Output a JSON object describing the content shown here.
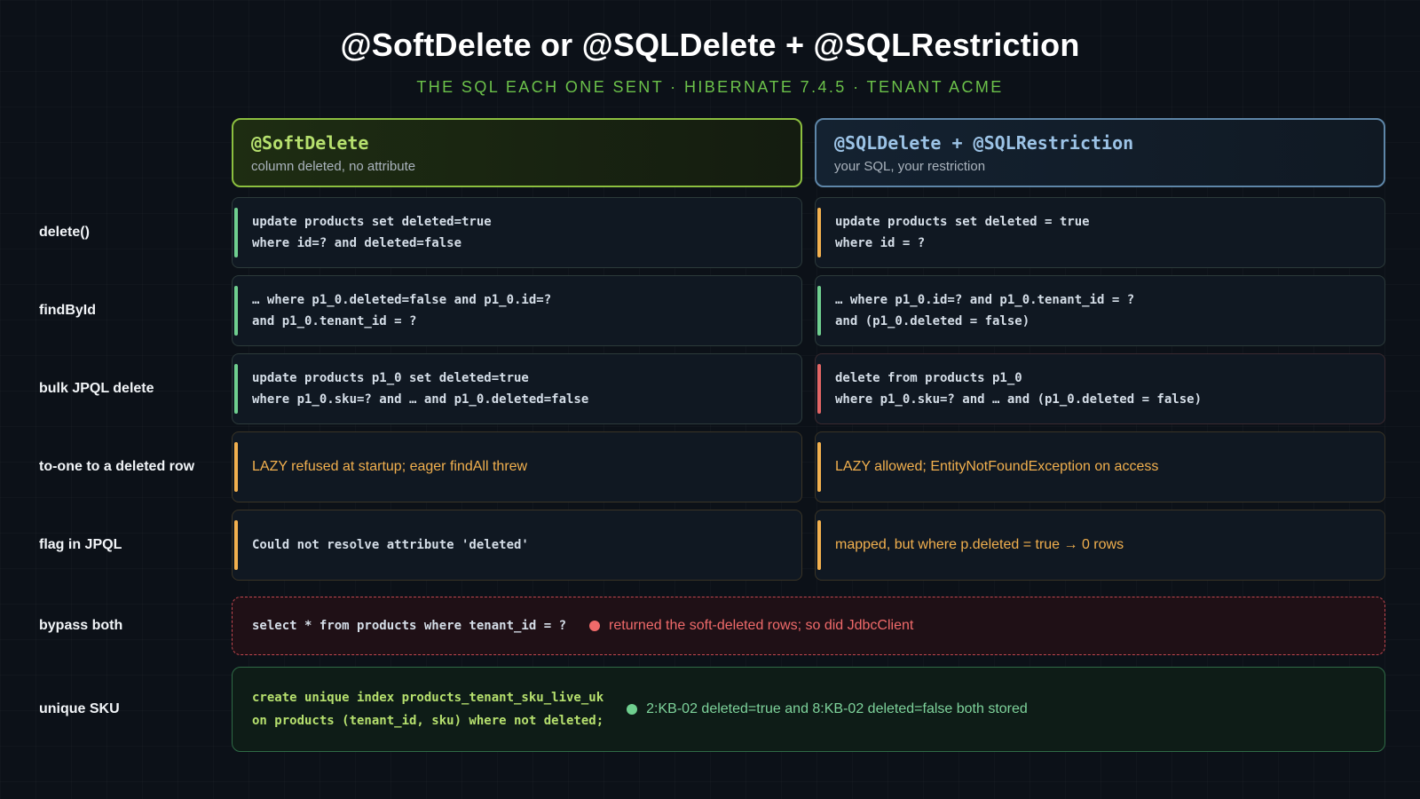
{
  "header": {
    "title": "@SoftDelete or @SQLDelete + @SQLRestriction",
    "subtitle": "THE SQL EACH ONE SENT · HIBERNATE 7.4.5 · TENANT ACME"
  },
  "columns": {
    "left": {
      "name": "@SoftDelete",
      "desc": "column deleted, no attribute"
    },
    "right": {
      "name": "@SQLDelete + @SQLRestriction",
      "desc": "your SQL, your restriction"
    }
  },
  "rows": [
    {
      "label": "delete()",
      "left": {
        "text": "update products set deleted=true\nwhere id=? and deleted=false",
        "status": "green"
      },
      "right": {
        "text": "update products set deleted = true\nwhere id = ?",
        "status": "amber"
      }
    },
    {
      "label": "findById",
      "left": {
        "text": "… where p1_0.deleted=false and p1_0.id=?\nand p1_0.tenant_id = ?",
        "status": "green"
      },
      "right": {
        "text": "… where p1_0.id=? and p1_0.tenant_id = ?\nand (p1_0.deleted = false)",
        "status": "green"
      }
    },
    {
      "label": "bulk JPQL delete",
      "left": {
        "text": "update products p1_0 set deleted=true\nwhere p1_0.sku=? and … and p1_0.deleted=false",
        "status": "green"
      },
      "right": {
        "text": "delete from products p1_0\nwhere p1_0.sku=? and … and (p1_0.deleted = false)",
        "status": "red"
      }
    },
    {
      "label": "to-one to a deleted row",
      "left": {
        "text": "LAZY refused at startup; eager findAll threw",
        "status": "amber"
      },
      "right": {
        "text": "LAZY allowed; EntityNotFoundException on access",
        "status": "amber"
      }
    },
    {
      "label": "flag in JPQL",
      "left": {
        "text": "Could not resolve attribute 'deleted'",
        "status": "amber"
      },
      "right": {
        "text": "mapped, but where p.deleted = true → 0 rows",
        "status": "amber"
      }
    }
  ],
  "bypass": {
    "label": "bypass both",
    "code": "select * from products where tenant_id = ?",
    "message": "returned the soft-deleted rows; so did JdbcClient",
    "status_color": "#f06a6a"
  },
  "unique": {
    "label": "unique SKU",
    "code": "create unique index products_tenant_sku_live_uk\non products (tenant_id, sku) where not deleted;",
    "message": "2:KB-02 deleted=true and 8:KB-02 deleted=false both stored",
    "status_color": "#6fcf8f"
  },
  "colors": {
    "green": "#6fcf8f",
    "amber": "#f2b04e",
    "red": "#e36565",
    "left_accent": "#8cbf3f",
    "right_accent": "#5e86a8"
  }
}
